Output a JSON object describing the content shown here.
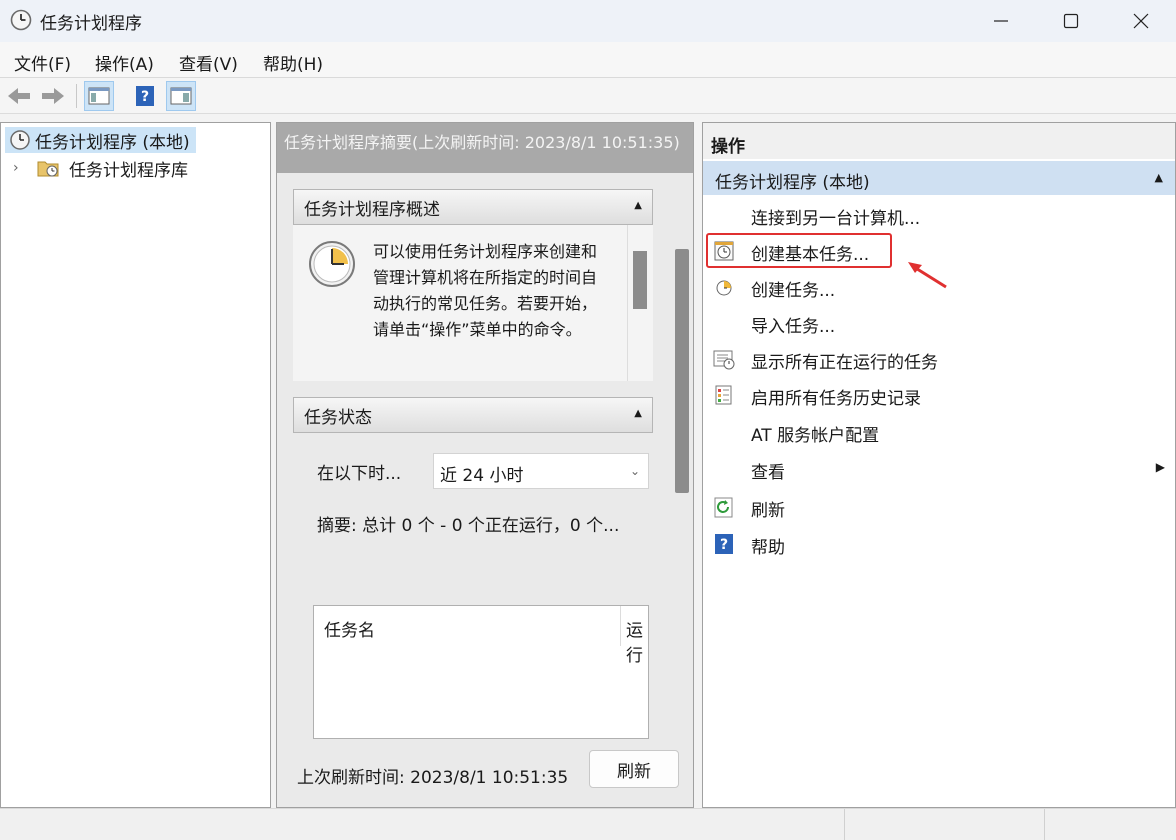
{
  "window": {
    "title": "任务计划程序",
    "minimize_icon": "minimize-icon",
    "maximize_icon": "maximize-icon",
    "close_icon": "close-icon"
  },
  "menu": [
    "文件(F)",
    "操作(A)",
    "查看(V)",
    "帮助(H)"
  ],
  "toolbar": {
    "icons": [
      "back-arrow-icon",
      "forward-arrow-icon",
      "show-hide-console-tree-icon",
      "help-icon",
      "show-hide-action-pane-icon"
    ]
  },
  "tree": {
    "root": "任务计划程序 (本地)",
    "child": "任务计划程序库"
  },
  "middle": {
    "header": "任务计划程序摘要(上次刷新时间: 2023/8/1 10:51:35)",
    "overview_title": "任务计划程序概述",
    "overview_text": "可以使用任务计划程序来创建和管理计算机将在所指定的时间自动执行的常见任务。若要开始，请单击“操作”菜单中的命令。",
    "status_title": "任务状态",
    "status_label": "在以下时...",
    "status_select": "近 24 小时",
    "summary": "摘要: 总计 0 个 - 0 个正在运行，0 个...",
    "table_col_name": "任务名",
    "table_col_run": "运行",
    "last_refresh": "上次刷新时间: 2023/8/1 10:51:35",
    "refresh_button": "刷新"
  },
  "actions": {
    "title": "操作",
    "group": "任务计划程序 (本地)",
    "items": [
      {
        "label": "连接到另一台计算机...",
        "icon": ""
      },
      {
        "label": "创建基本任务...",
        "icon": "create-basic-task-icon"
      },
      {
        "label": "创建任务...",
        "icon": "create-task-icon"
      },
      {
        "label": "导入任务...",
        "icon": ""
      },
      {
        "label": "显示所有正在运行的任务",
        "icon": "running-tasks-icon"
      },
      {
        "label": "启用所有任务历史记录",
        "icon": "task-history-icon"
      },
      {
        "label": "AT 服务帐户配置",
        "icon": ""
      },
      {
        "label": "查看",
        "icon": ""
      },
      {
        "label": "刷新",
        "icon": "refresh-icon"
      },
      {
        "label": "帮助",
        "icon": "help-icon"
      }
    ]
  },
  "colors": {
    "accent_highlight": "#e03030",
    "selection": "#cce4f7",
    "group_header": "#cfe0f2"
  }
}
